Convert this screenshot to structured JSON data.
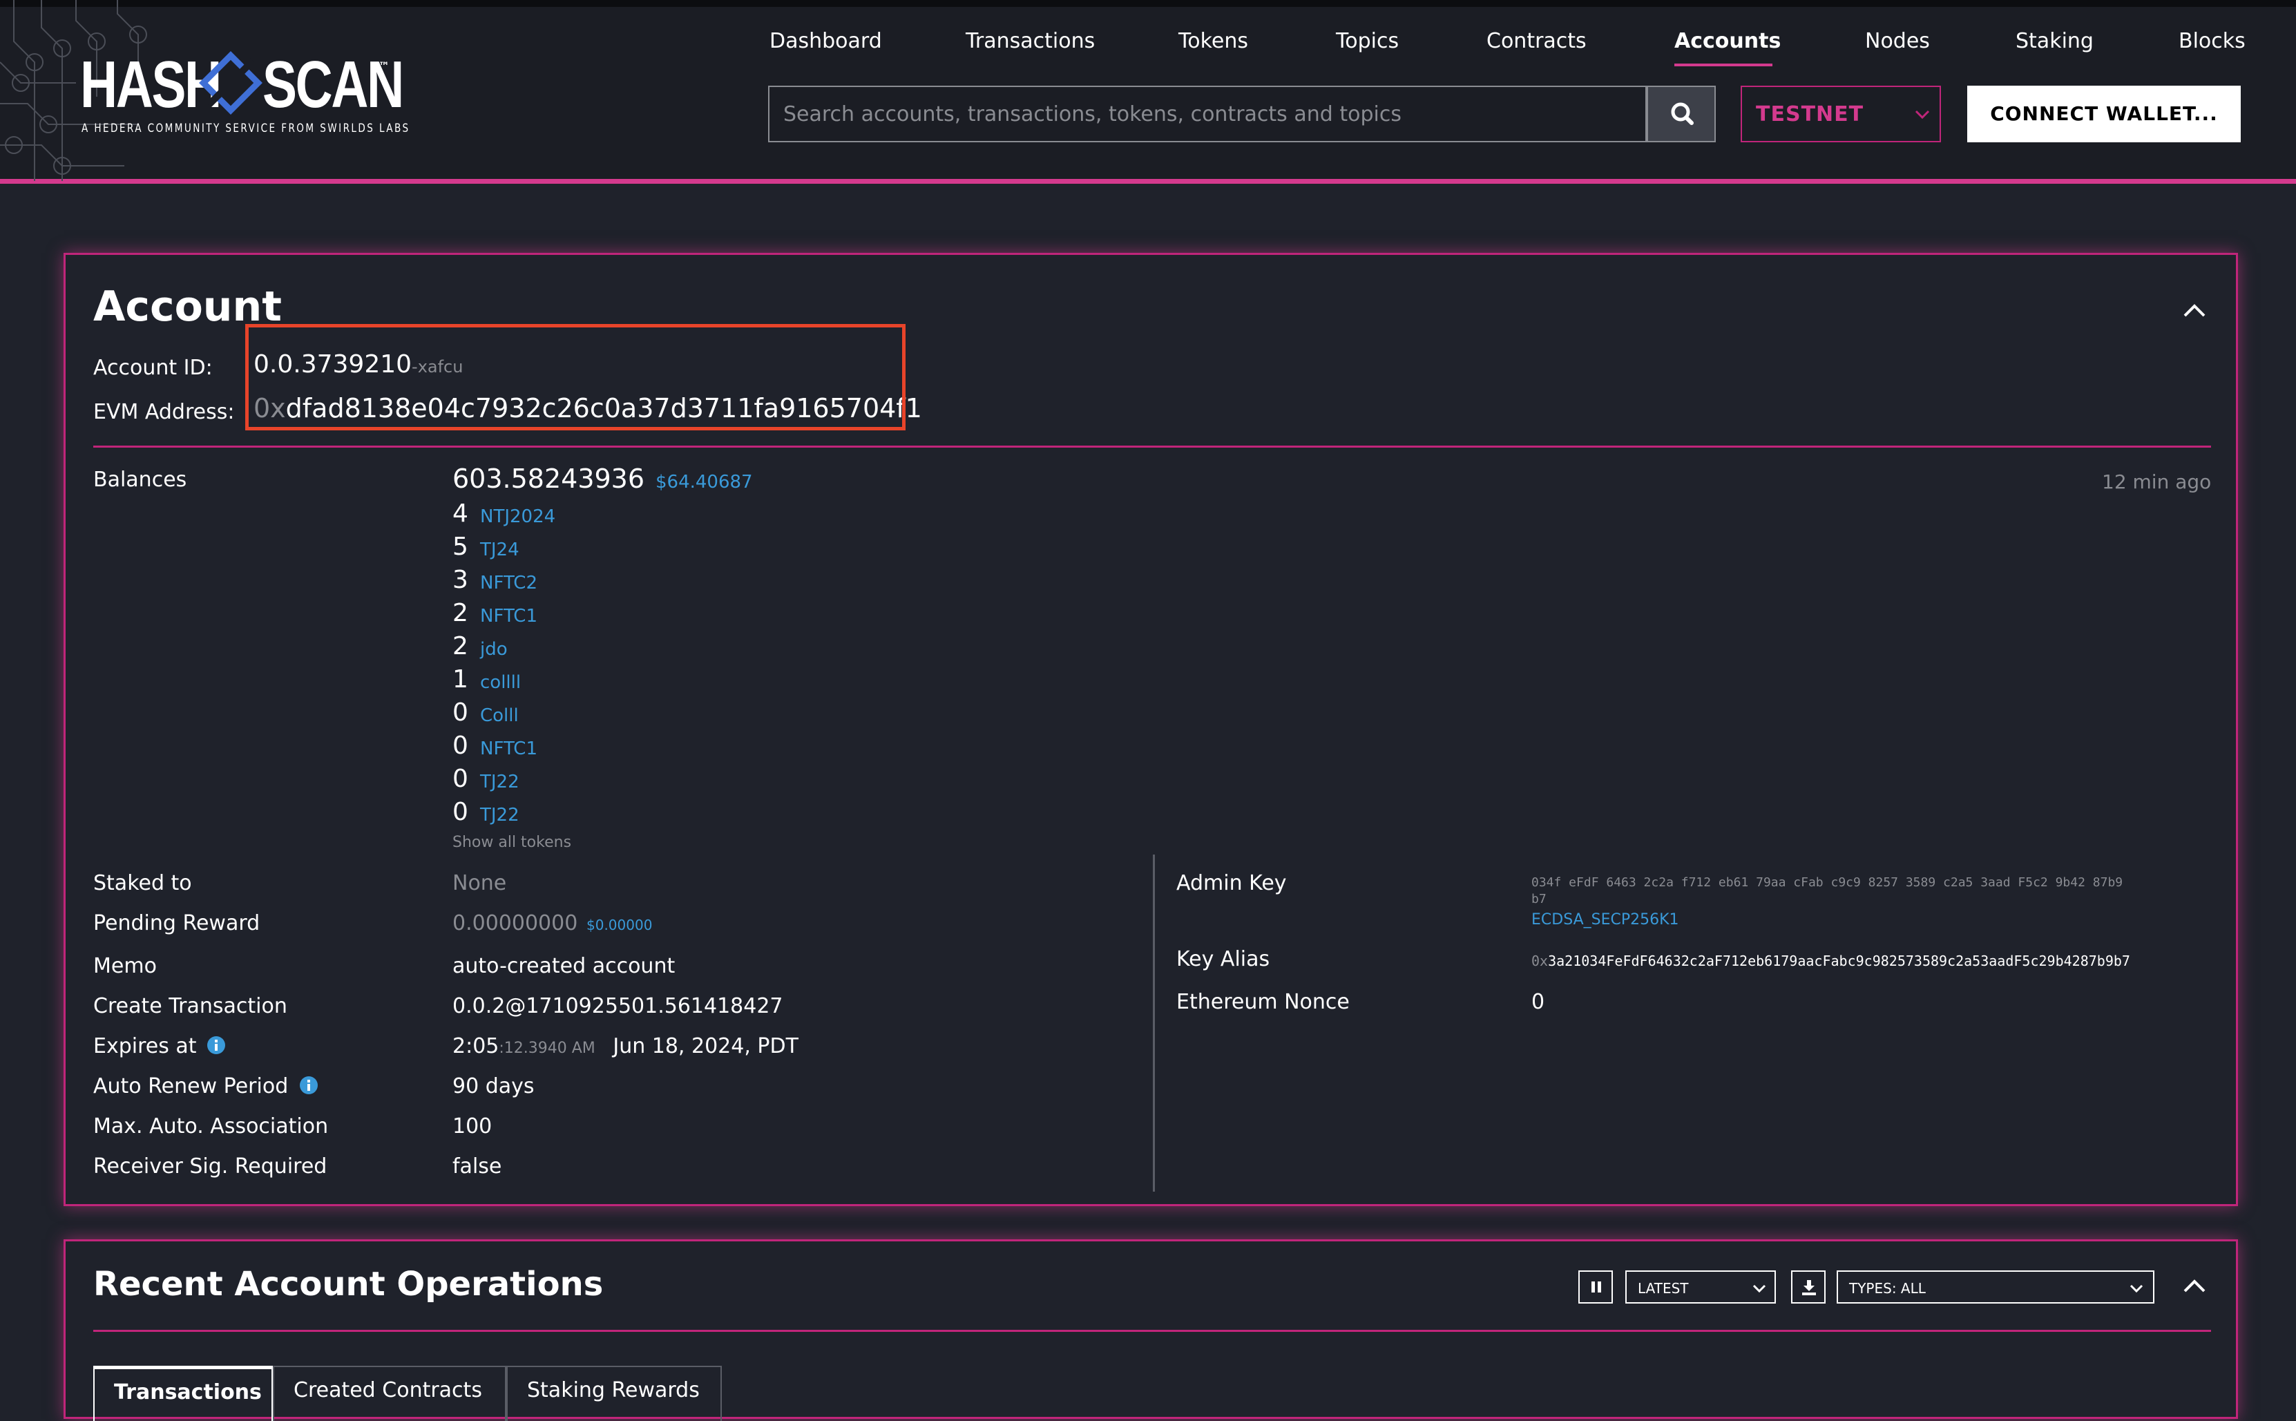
{
  "header": {
    "logo": {
      "left": "HASH",
      "right": "SCAN",
      "tm": "™",
      "tagline": "A HEDERA COMMUNITY SERVICE FROM SWIRLDS LABS"
    },
    "nav": [
      {
        "label": "Dashboard",
        "active": false
      },
      {
        "label": "Transactions",
        "active": false
      },
      {
        "label": "Tokens",
        "active": false
      },
      {
        "label": "Topics",
        "active": false
      },
      {
        "label": "Contracts",
        "active": false
      },
      {
        "label": "Accounts",
        "active": true
      },
      {
        "label": "Nodes",
        "active": false
      },
      {
        "label": "Staking",
        "active": false
      },
      {
        "label": "Blocks",
        "active": false
      }
    ],
    "search_placeholder": "Search accounts, transactions, tokens, contracts and topics",
    "network": "TESTNET",
    "connect_label": "CONNECT WALLET..."
  },
  "account": {
    "title": "Account",
    "account_id_label": "Account ID:",
    "account_id": "0.0.3739210",
    "account_id_checksum": "-xafcu",
    "evm_label": "EVM Address:",
    "evm_prefix": "0x",
    "evm_address": "dfad8138e04c7932c26c0a37d3711fa9165704f1",
    "balances_label": "Balances",
    "hbar_balance": "603.58243936",
    "usd_balance": "$64.40687",
    "updated": "12 min ago",
    "tokens": [
      {
        "qty": "4",
        "name": "NTJ2024"
      },
      {
        "qty": "5",
        "name": "TJ24"
      },
      {
        "qty": "3",
        "name": "NFTC2"
      },
      {
        "qty": "2",
        "name": "NFTC1"
      },
      {
        "qty": "2",
        "name": "jdo"
      },
      {
        "qty": "1",
        "name": "collll"
      },
      {
        "qty": "0",
        "name": "Colll"
      },
      {
        "qty": "0",
        "name": "NFTC1"
      },
      {
        "qty": "0",
        "name": "TJ22"
      },
      {
        "qty": "0",
        "name": "TJ22"
      }
    ],
    "show_all_tokens": "Show all tokens",
    "left_fields": {
      "staked_to": {
        "label": "Staked to",
        "value": "None"
      },
      "pending_reward": {
        "label": "Pending Reward",
        "value": "0.00000000",
        "usd": "$0.00000"
      },
      "memo": {
        "label": "Memo",
        "value": "auto-created account"
      },
      "create_tx": {
        "label": "Create Transaction",
        "value": "0.0.2@1710925501.561418427"
      },
      "expires_at": {
        "label": "Expires at",
        "time": "2:05",
        "time_frac": ":12.3940 AM",
        "date": "Jun 18, 2024, PDT"
      },
      "auto_renew": {
        "label": "Auto Renew Period",
        "value": "90 days"
      },
      "max_assoc": {
        "label": "Max. Auto. Association",
        "value": "100"
      },
      "receiver_sig": {
        "label": "Receiver Sig. Required",
        "value": "false"
      }
    },
    "right_fields": {
      "admin_key": {
        "label": "Admin Key",
        "value_line1": "034f eFdF 6463 2c2a f712 eb61 79aa cFab c9c9 8257 3589 c2a5 3aad F5c2 9b42 87b9",
        "value_line2": "b7",
        "type": "ECDSA_SECP256K1"
      },
      "key_alias": {
        "label": "Key Alias",
        "prefix": "0x",
        "value": "3a21034FeFdF64632c2aF712eb6179aacFabc9c982573589c2a53aadF5c29b4287b9b7"
      },
      "eth_nonce": {
        "label": "Ethereum Nonce",
        "value": "0"
      }
    }
  },
  "operations": {
    "title": "Recent Account Operations",
    "latest_label": "LATEST",
    "types_label": "TYPES: ALL",
    "tabs": [
      "Transactions",
      "Created Contracts",
      "Staking Rewards"
    ]
  },
  "colors": {
    "accent": "#d43a8e",
    "link": "#3a9ad9",
    "highlight": "#e8442a",
    "background": "#1f222b"
  }
}
